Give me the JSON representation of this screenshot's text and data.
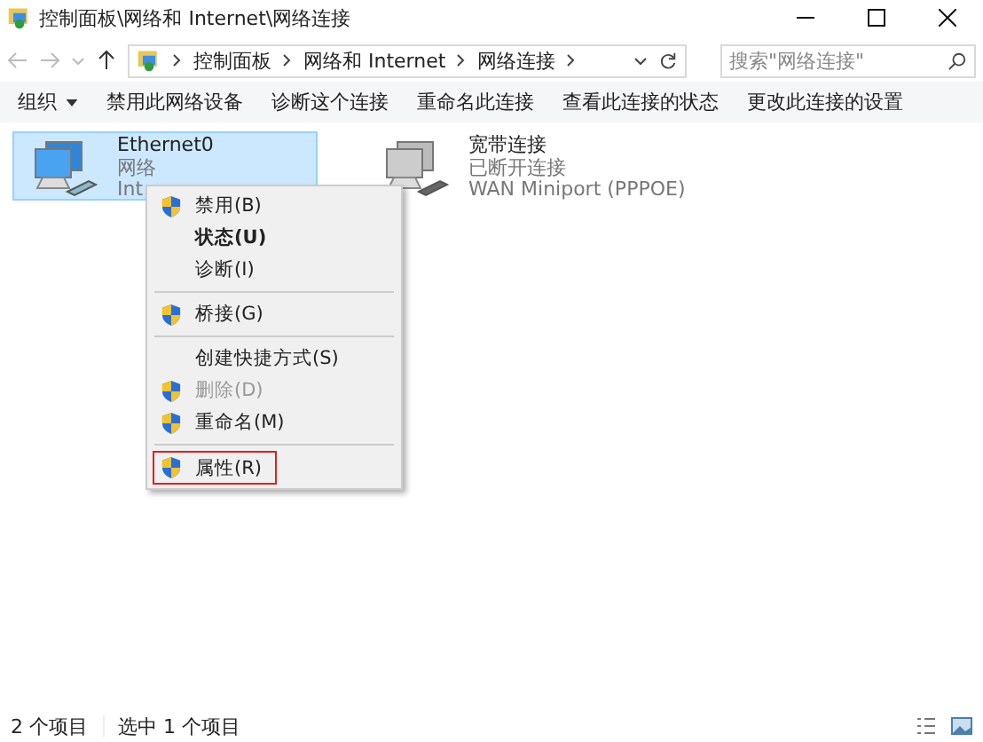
{
  "window": {
    "title": "控制面板\\网络和 Internet\\网络连接"
  },
  "address_bar": {
    "segments": [
      "控制面板",
      "网络和 Internet",
      "网络连接"
    ]
  },
  "search": {
    "placeholder": "搜索\"网络连接\""
  },
  "toolbar": [
    {
      "label": "组织",
      "dropdown": true
    },
    {
      "label": "禁用此网络设备",
      "dropdown": false
    },
    {
      "label": "诊断这个连接",
      "dropdown": false
    },
    {
      "label": "重命名此连接",
      "dropdown": false
    },
    {
      "label": "查看此连接的状态",
      "dropdown": false
    },
    {
      "label": "更改此连接的设置",
      "dropdown": false
    }
  ],
  "connections": [
    {
      "name": "Ethernet0",
      "status": "网络",
      "device": "Int",
      "selected": true,
      "connected": true
    },
    {
      "name": "宽带连接",
      "status": "已断开连接",
      "device": "WAN Miniport (PPPOE)",
      "selected": false,
      "connected": false
    }
  ],
  "context_menu": [
    [
      {
        "label": "禁用(B)",
        "shield": true,
        "bold": false,
        "disabled": false,
        "outlined": false
      },
      {
        "label": "状态(U)",
        "shield": false,
        "bold": true,
        "disabled": false,
        "outlined": false
      },
      {
        "label": "诊断(I)",
        "shield": false,
        "bold": false,
        "disabled": false,
        "outlined": false
      }
    ],
    [
      {
        "label": "桥接(G)",
        "shield": true,
        "bold": false,
        "disabled": false,
        "outlined": false
      }
    ],
    [
      {
        "label": "创建快捷方式(S)",
        "shield": false,
        "bold": false,
        "disabled": false,
        "outlined": false
      },
      {
        "label": "删除(D)",
        "shield": true,
        "bold": false,
        "disabled": true,
        "outlined": false
      },
      {
        "label": "重命名(M)",
        "shield": true,
        "bold": false,
        "disabled": false,
        "outlined": false
      }
    ],
    [
      {
        "label": "属性(R)",
        "shield": true,
        "bold": false,
        "disabled": false,
        "outlined": true
      }
    ]
  ],
  "status_bar": {
    "count": "2 个项目",
    "selection": "选中 1 个项目"
  }
}
